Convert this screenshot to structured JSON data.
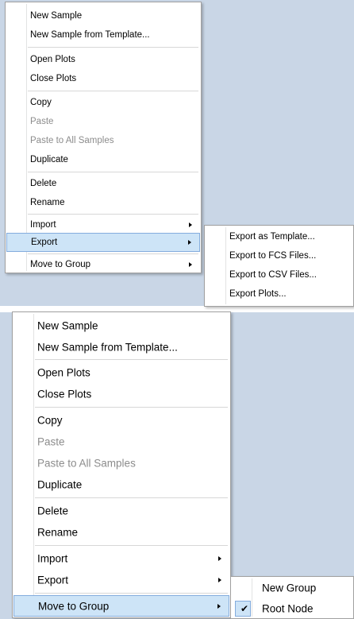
{
  "top_menu": {
    "items": [
      {
        "label": "New Sample"
      },
      {
        "label": "New Sample from Template..."
      },
      {
        "label": "Open Plots"
      },
      {
        "label": "Close Plots"
      },
      {
        "label": "Copy"
      },
      {
        "label": "Paste",
        "disabled": true
      },
      {
        "label": "Paste to All Samples",
        "disabled": true
      },
      {
        "label": "Duplicate"
      },
      {
        "label": "Delete"
      },
      {
        "label": "Rename"
      },
      {
        "label": "Import",
        "has_submenu": true
      },
      {
        "label": "Export",
        "has_submenu": true,
        "selected": true
      },
      {
        "label": "Move to Group",
        "has_submenu": true
      }
    ],
    "submenu": {
      "parent": "Export",
      "items": [
        {
          "label": "Export as Template..."
        },
        {
          "label": "Export to FCS Files..."
        },
        {
          "label": "Export to CSV Files..."
        },
        {
          "label": "Export Plots..."
        }
      ]
    }
  },
  "bottom_menu": {
    "items": [
      {
        "label": "New Sample"
      },
      {
        "label": "New Sample from Template..."
      },
      {
        "label": "Open Plots"
      },
      {
        "label": "Close Plots"
      },
      {
        "label": "Copy"
      },
      {
        "label": "Paste",
        "disabled": true
      },
      {
        "label": "Paste to All Samples",
        "disabled": true
      },
      {
        "label": "Duplicate"
      },
      {
        "label": "Delete"
      },
      {
        "label": "Rename"
      },
      {
        "label": "Import",
        "has_submenu": true
      },
      {
        "label": "Export",
        "has_submenu": true
      },
      {
        "label": "Move to Group",
        "has_submenu": true,
        "selected": true
      }
    ],
    "submenu": {
      "parent": "Move to Group",
      "items": [
        {
          "label": "New Group"
        },
        {
          "label": "Root Node",
          "checked": true
        }
      ]
    }
  },
  "colors": {
    "background": "#c9d6e6",
    "highlight": "#cde4f7",
    "highlight_border": "#84acdd",
    "disabled_text": "#8c8c8c"
  },
  "icons": {
    "submenu_arrow": "chevron-right-icon",
    "check": "checkmark-icon"
  }
}
